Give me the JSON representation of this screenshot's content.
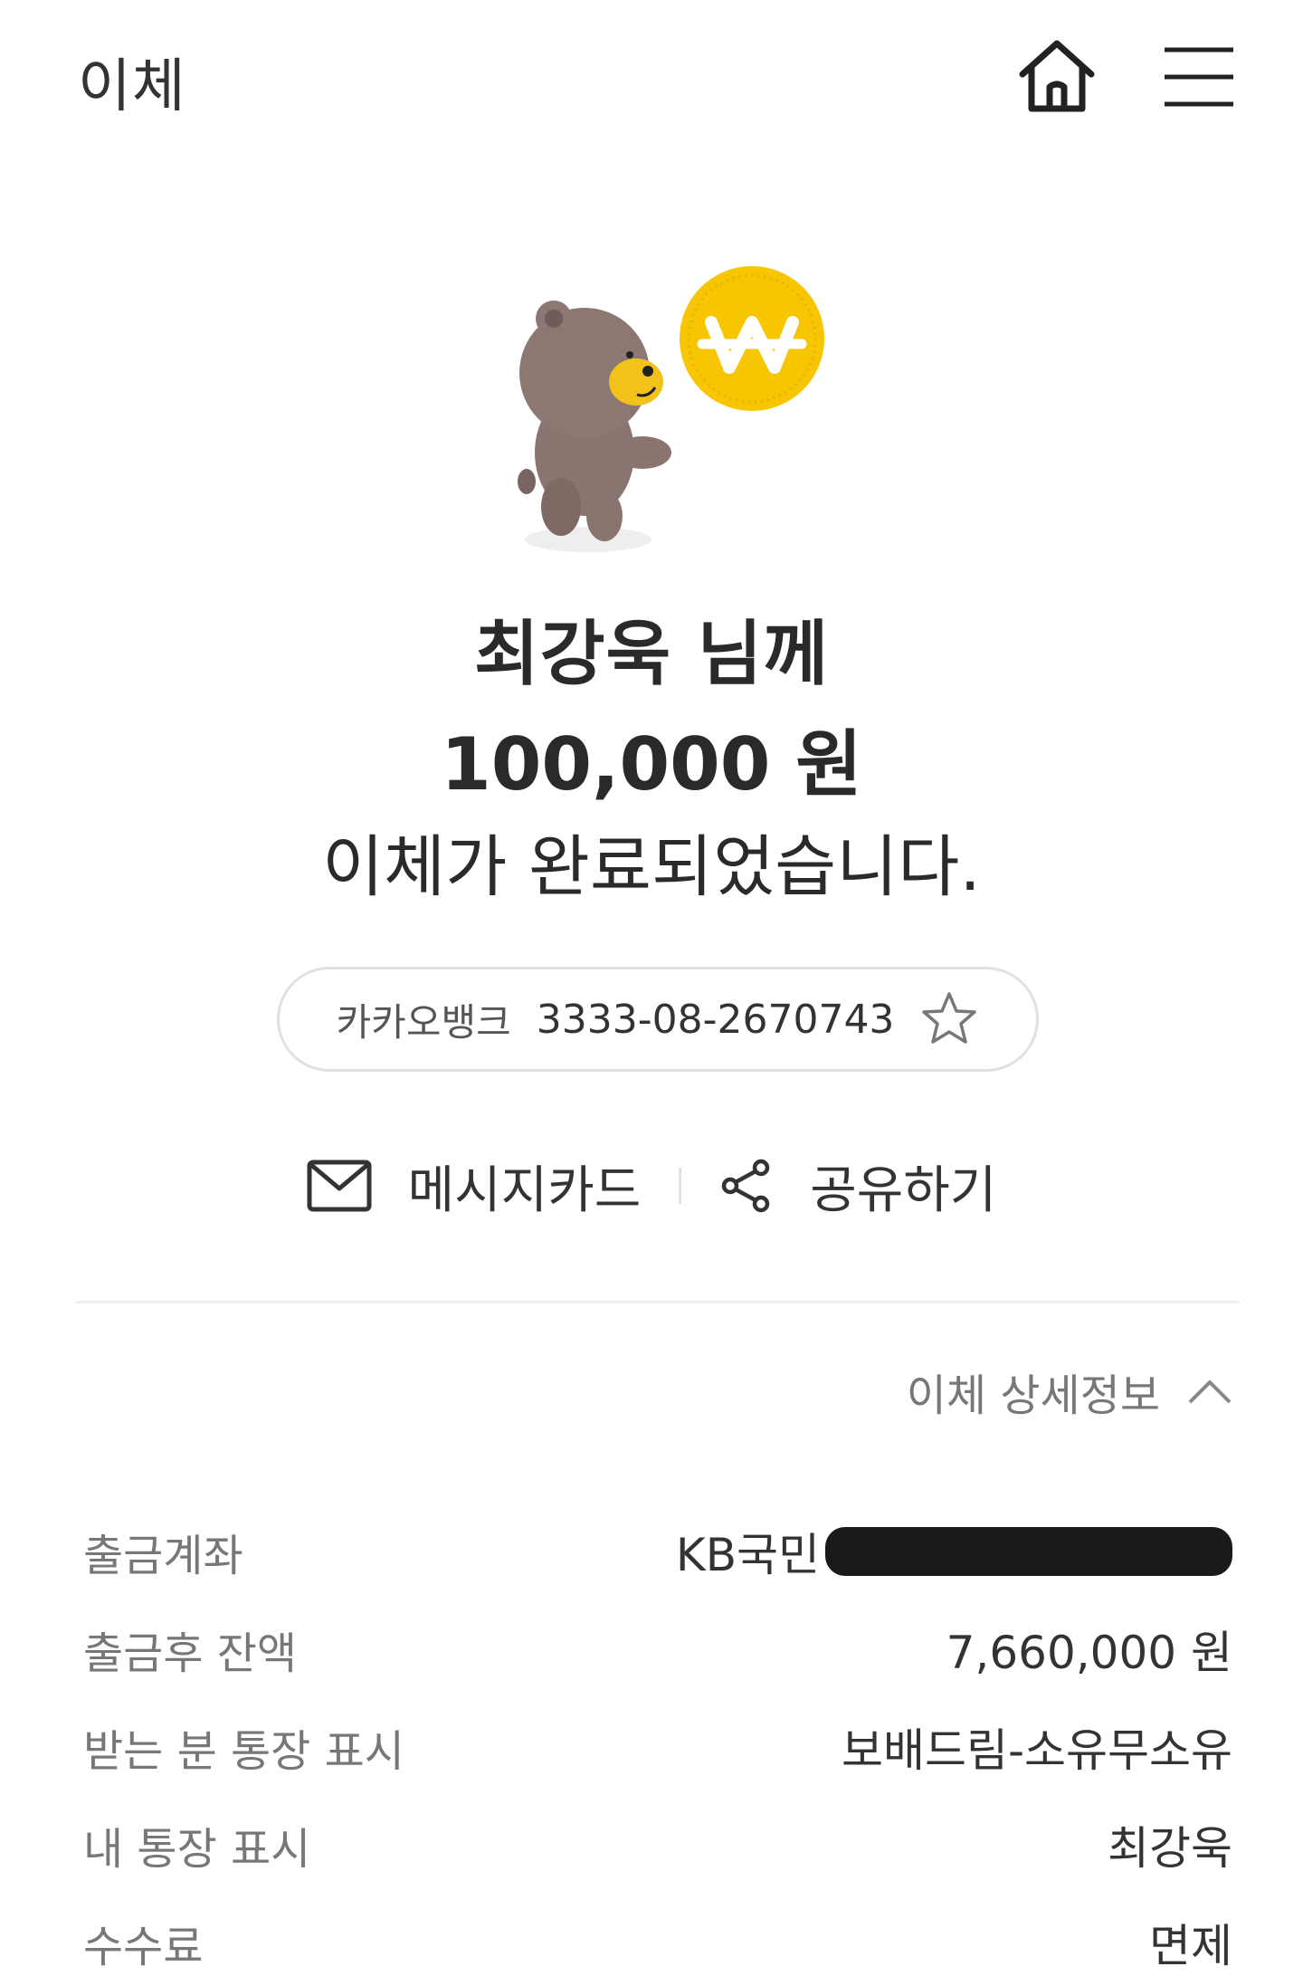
{
  "header": {
    "title": "이체",
    "home_icon": "home-icon",
    "menu_icon": "hamburger-menu-icon"
  },
  "hero": {
    "coin_symbol": "₩",
    "colors": {
      "coin": "#f7c600",
      "bear": "#8a7470",
      "muzzle": "#f3c21a"
    }
  },
  "result": {
    "recipient": "최강욱 님께",
    "amount": "100,000 원",
    "message": "이체가 완료되었습니다."
  },
  "account": {
    "bank": "카카오뱅크",
    "number": "3333-08-2670743",
    "favorite_icon": "star-outline-icon"
  },
  "actions": {
    "message_card": "메시지카드",
    "share": "공유하기"
  },
  "details": {
    "toggle_label": "이체 상세정보",
    "rows": [
      {
        "label": "출금계좌",
        "value": "KB국민"
      },
      {
        "label": "출금후 잔액",
        "value": "7,660,000 원"
      },
      {
        "label": "받는 분 통장 표시",
        "value": "보배드림-소유무소유"
      },
      {
        "label": "내 통장 표시",
        "value": "최강욱"
      },
      {
        "label": "수수료",
        "value": "면제"
      }
    ]
  }
}
